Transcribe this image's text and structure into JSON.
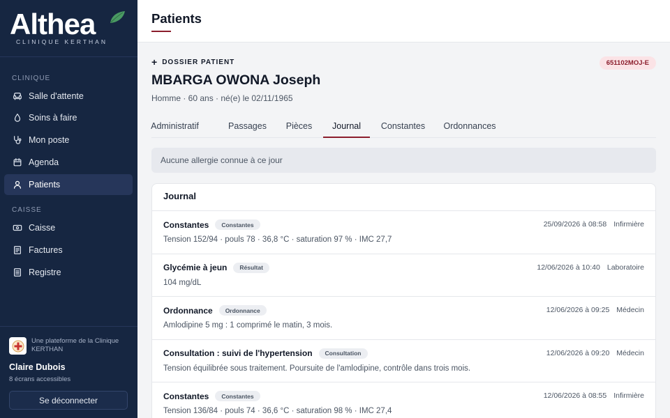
{
  "brand": {
    "name": "Althea",
    "subtitle": "CLINIQUE KERTHAN",
    "leaf_color": "#4a9a63"
  },
  "sidebar": {
    "sections": [
      {
        "label": "CLINIQUE",
        "items": [
          {
            "label": "Salle d'attente",
            "icon": "armchair-icon"
          },
          {
            "label": "Soins à faire",
            "icon": "droplet-icon"
          },
          {
            "label": "Mon poste",
            "icon": "stethoscope-icon"
          },
          {
            "label": "Agenda",
            "icon": "calendar-icon"
          },
          {
            "label": "Patients",
            "icon": "user-icon",
            "active": true
          }
        ]
      },
      {
        "label": "CAISSE",
        "items": [
          {
            "label": "Caisse",
            "icon": "banknote-icon"
          },
          {
            "label": "Factures",
            "icon": "receipt-icon"
          },
          {
            "label": "Registre",
            "icon": "ledger-icon"
          }
        ]
      }
    ],
    "footer": {
      "platform": "Une plateforme de la Clinique KERTHAN",
      "user": "Claire Dubois",
      "screens": "8 écrans accessibles",
      "logout": "Se déconnecter"
    }
  },
  "header": {
    "title": "Patients"
  },
  "patient": {
    "section_label": "DOSSIER PATIENT",
    "id": "651102MOJ-E",
    "name": "MBARGA OWONA Joseph",
    "meta": "Homme · 60 ans · né(e) le 02/11/1965"
  },
  "tabs": [
    {
      "label": "Administratif"
    },
    {
      "label": "Passages"
    },
    {
      "label": "Pièces"
    },
    {
      "label": "Journal",
      "active": true
    },
    {
      "label": "Constantes"
    },
    {
      "label": "Ordonnances"
    }
  ],
  "allergy": "Aucune allergie connue à ce jour",
  "journal": {
    "title": "Journal",
    "entries": [
      {
        "title": "Constantes",
        "badge": "Constantes",
        "date": "25/09/2026 à 08:58",
        "role": "Infirmière",
        "text": "Tension 152/94 · pouls 78 · 36,8 °C · saturation 97 % · IMC 27,7"
      },
      {
        "title": "Glycémie à jeun",
        "badge": "Résultat",
        "date": "12/06/2026 à 10:40",
        "role": "Laboratoire",
        "text": "104 mg/dL"
      },
      {
        "title": "Ordonnance",
        "badge": "Ordonnance",
        "date": "12/06/2026 à 09:25",
        "role": "Médecin",
        "text": "Amlodipine 5 mg : 1 comprimé le matin, 3 mois."
      },
      {
        "title": "Consultation : suivi de l'hypertension",
        "badge": "Consultation",
        "date": "12/06/2026 à 09:20",
        "role": "Médecin",
        "text": "Tension équilibrée sous traitement. Poursuite de l'amlodipine, contrôle dans trois mois."
      },
      {
        "title": "Constantes",
        "badge": "Constantes",
        "date": "12/06/2026 à 08:55",
        "role": "Infirmière",
        "text": "Tension 136/84 · pouls 74 · 36,6 °C · saturation 98 % · IMC 27,4"
      }
    ]
  },
  "colors": {
    "sidebar_bg": "#162641",
    "accent": "#8b1d2c",
    "active_item": "#26365a"
  }
}
